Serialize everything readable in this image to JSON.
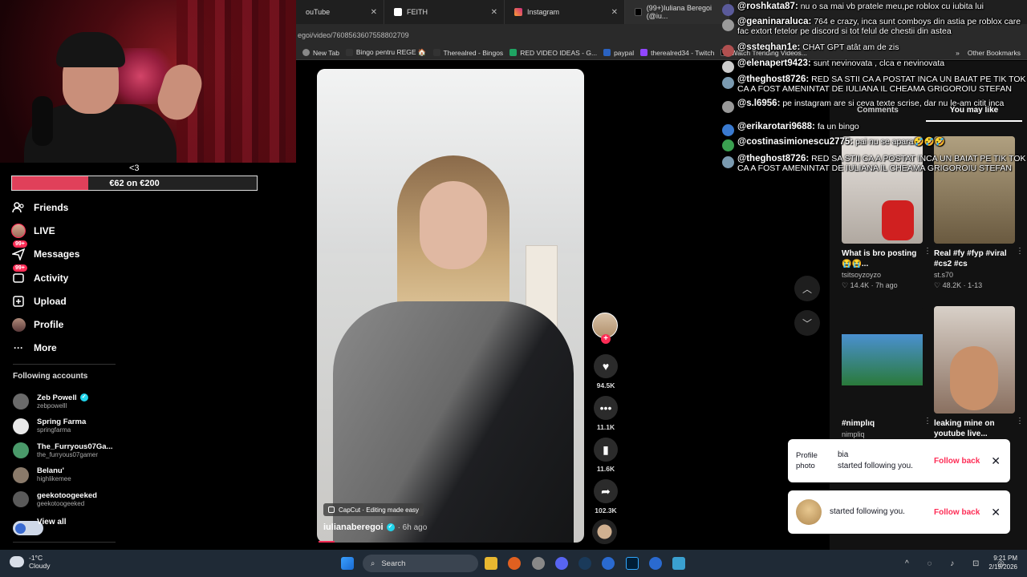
{
  "browser": {
    "tabs": [
      {
        "label": "ouTube",
        "active": false
      },
      {
        "label": "FEITH",
        "active": false
      },
      {
        "label": "Instagram",
        "active": false
      },
      {
        "label": "(99+)Iuliana Beregoi (@iu...",
        "active": true
      }
    ],
    "url": "egoi/video/7608563607558802709",
    "bookmarks": [
      "New Tab",
      "Bingo pentru REGE 🏠",
      "Therealred - Bingos",
      "RED VIDEO IDEAS - G...",
      "paypal",
      "therealred34 - Twitch",
      "Watch Trending Videos..."
    ],
    "other_bookmarks": "Other Bookmarks"
  },
  "goal": {
    "text": "€62 on €200",
    "progress": 0.31,
    "heart": "<3"
  },
  "nav": [
    {
      "label": "Friends",
      "icon": "friends-icon"
    },
    {
      "label": "LIVE",
      "icon": "live-icon"
    },
    {
      "label": "Messages",
      "icon": "messages-icon",
      "badge": "99+"
    },
    {
      "label": "Activity",
      "icon": "activity-icon",
      "badge": "99+"
    },
    {
      "label": "Upload",
      "icon": "upload-icon"
    },
    {
      "label": "Profile",
      "icon": "profile-icon"
    },
    {
      "label": "More",
      "icon": "more-icon"
    }
  ],
  "following": {
    "title": "Following accounts",
    "accounts": [
      {
        "name": "Zeb Powell",
        "user": "zebpowelll",
        "verified": true,
        "color": "#6a6a6a"
      },
      {
        "name": "Spring Farma",
        "user": "springfarma",
        "verified": false,
        "color": "#e8e8e8"
      },
      {
        "name": "The_Furryous07Ga...",
        "user": "the_furryous07gamer",
        "verified": false,
        "color": "#4a9a6a"
      },
      {
        "name": "Belanu'",
        "user": "highlikemee",
        "verified": false,
        "color": "#8a7a6a"
      },
      {
        "name": "geekotoogeeked",
        "user": "geekotoogeeked",
        "verified": false,
        "color": "#5a5a5a"
      }
    ],
    "view_all": "View all"
  },
  "video": {
    "capcut": "CapCut · Editing made easy",
    "author": "iulianaberegoi",
    "time": "· 6h ago",
    "likes": "94.5K",
    "comments": "11.1K",
    "saves": "11.6K",
    "shares": "102.3K"
  },
  "right_panel": {
    "tabs": [
      "Comments",
      "You may like"
    ],
    "cards": [
      {
        "title": "What is bro posting 😭😭...",
        "author": "tsitsoyzoyzo",
        "meta": "♡ 14.4K · 7h ago"
      },
      {
        "title": "Real #fy #fyp #viral #cs2 #cs",
        "author": "st.s70",
        "meta": "♡ 48.2K · 1-13"
      },
      {
        "title": "#nimplıq",
        "author": "nimpliq",
        "meta": ""
      },
      {
        "title": "leaking mine on youtube live...",
        "author": "",
        "meta": ""
      }
    ]
  },
  "chat": [
    {
      "user": "@roshkata87:",
      "msg": "nu o sa mai vb pratele meu,pe roblox cu iubita lui",
      "color": "#5a5a9a"
    },
    {
      "user": "@geaninaraluca:",
      "msg": "764 e crazy, inca sunt comboys din astia pe roblox care fac extort fetelor pe discord si tot felul de chestii din astea",
      "color": "#9a9a9a"
    },
    {
      "user": "@ssteqhan1e:",
      "msg": "CHAT GPT atât am de zis",
      "color": "#b05050"
    },
    {
      "user": "@elenapert9423:",
      "msg": "sunt nevinovata , clca e nevinovata",
      "color": "#cccccc"
    },
    {
      "user": "@theghost8726:",
      "msg": "RED SA STII CA A POSTAT INCA UN BAIAT PE TIK TOK CA A FOST AMENINTAT DE IULIANA IL CHEAMA GRIGOROIU STEFAN",
      "color": "#7a9ab0"
    },
    {
      "user": "@s.l6956:",
      "msg": "pe instagram are si ceva texte scrise, dar nu le-am citit inca",
      "color": "#999999"
    },
    {
      "user": "@erikarotari9688:",
      "msg": "fa un bingo",
      "color": "#3a7ad0"
    },
    {
      "user": "@costinasimionescu2775:",
      "msg": "pai nu se apara🤣🤣🤣",
      "color": "#3aa050"
    },
    {
      "user": "@theghost8726:",
      "msg": "RED SA STII CA A POSTAT INCA UN BAIAT PE TIK TOK CA A FOST AMENINTAT DE IULIANA IL CHEAMA GRIGOROIU STEFAN",
      "color": "#7a9ab0"
    }
  ],
  "toasts": [
    {
      "label": "Profile photo",
      "name": "bia",
      "text": "started following you.",
      "action": "Follow back"
    },
    {
      "label": "",
      "name": "",
      "text": "started following you.",
      "action": "Follow back"
    }
  ],
  "taskbar": {
    "temp": "-1°C",
    "weather": "Cloudy",
    "search": "Search",
    "time": "9:21 PM",
    "date": "2/19/2026"
  }
}
